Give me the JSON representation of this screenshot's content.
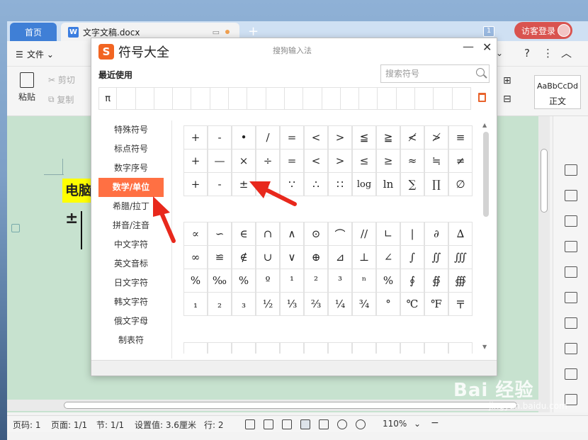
{
  "window": {
    "tab_home": "首页",
    "tab_doc": "文字文稿.docx",
    "tab_doc_badge": "W",
    "add_tab": "+",
    "window_count": "1",
    "login_label": "访客登录"
  },
  "menubar": {
    "file_label": "文件"
  },
  "toolbar": {
    "paste_label": "粘贴",
    "cut_label": "剪切",
    "copy_label": "复制",
    "style_sample": "AaBbCcDd",
    "style_name": "正文"
  },
  "document": {
    "heading": "电脑",
    "inserted_symbol": "±"
  },
  "dialog": {
    "title": "符号大全",
    "logo": "S",
    "subtitle": "搜狗输入法",
    "recent_label": "最近使用",
    "search_placeholder": "搜索符号",
    "recent_symbols": [
      "π",
      "",
      "",
      "",
      "",
      "",
      "",
      "",
      "",
      "",
      "",
      "",
      "",
      "",
      "",
      "",
      "",
      "",
      "",
      ""
    ],
    "categories": [
      "特殊符号",
      "标点符号",
      "数字序号",
      "数学/单位",
      "希腊/拉丁",
      "拼音/注音",
      "中文字符",
      "英文音标",
      "日文字符",
      "韩文字符",
      "俄文字母",
      "制表符"
    ],
    "active_category": "数学/单位",
    "grid_a": [
      "+",
      "-",
      "•",
      "/",
      "=",
      "<",
      ">",
      "≦",
      "≧",
      "≮",
      "≯",
      "≡",
      "+",
      "—",
      "×",
      "÷",
      "=",
      "<",
      ">",
      "≤",
      "≥",
      "≈",
      "≒",
      "≠",
      "+",
      "-",
      "±",
      ":",
      "∵",
      "∴",
      "∷",
      "log",
      "ln",
      "∑",
      "∏",
      "∅"
    ],
    "grid_b": [
      "∝",
      "∽",
      "∈",
      "∩",
      "∧",
      "⊙",
      "⌒",
      "//",
      "∟",
      "|",
      "∂",
      "∆",
      "∞",
      "≌",
      "∉",
      "∪",
      "∨",
      "⊕",
      "⊿",
      "⊥",
      "∠",
      "∫",
      "∬",
      "∭",
      "%",
      "‰",
      "%",
      "º",
      "¹",
      "²",
      "³",
      "ⁿ",
      "%",
      "∮",
      "∯",
      "∰",
      "₁",
      "₂",
      "₃",
      "½",
      "⅓",
      "⅔",
      "¼",
      "¾",
      "°",
      "℃",
      "℉",
      "〒"
    ],
    "grid_c": [
      "",
      "",
      "",
      "",
      "",
      "",
      "",
      "",
      "",
      "",
      "",
      ""
    ]
  },
  "statusbar": {
    "page_num": "页码: 1",
    "page": "页面: 1/1",
    "section": "节: 1/1",
    "setting": "设置值: 3.6厘米",
    "row": "行: 2",
    "zoom": "110%",
    "zoom_minus": "−"
  },
  "watermark": {
    "text": "Bai 经验",
    "sub": "jingyan.baidu.com"
  },
  "colors": {
    "accent": "#ff7043",
    "tab_home": "#3f7fd6",
    "login": "#d9534f",
    "doc_bg": "#c7e2cf",
    "highlight": "#ffff00",
    "arrow": "#e8281c"
  }
}
